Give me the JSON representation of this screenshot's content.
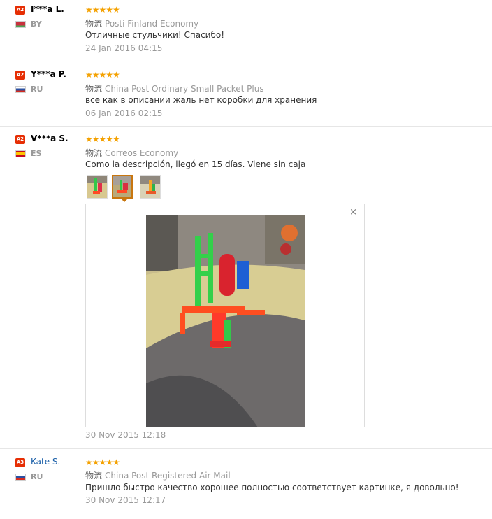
{
  "reviews": [
    {
      "level": "A2",
      "name": "I***a L.",
      "country": "BY",
      "stars": "★★★★★",
      "shipping_cn": "物流",
      "shipping": "Posti Finland Economy",
      "text": "Отличные стульчики! Спасибо!",
      "date": "24 Jan 2016 04:15"
    },
    {
      "level": "A2",
      "name": "Y***a P.",
      "country": "RU",
      "stars": "★★★★★",
      "shipping_cn": "物流",
      "shipping": "China Post Ordinary Small Packet Plus",
      "text": "все как в описании жаль нет коробки для хранения",
      "date": "06 Jan 2016 02:15"
    },
    {
      "level": "A2",
      "name": "V***a S.",
      "country": "ES",
      "stars": "★★★★★",
      "shipping_cn": "物流",
      "shipping": "Correos Economy",
      "text": "Como la descripción, llegó en 15 días. Viene sin caja",
      "date": "30 Nov 2015 12:18",
      "viewer_close": "×"
    },
    {
      "level": "A3",
      "name": "Kate S.",
      "country": "RU",
      "stars": "★★★★★",
      "shipping_cn": "物流",
      "shipping": "China Post Registered Air Mail",
      "text": "Пришло быстро качество хорошее полностью соответствует картинке, я довольно!",
      "date": "30 Nov 2015 12:17"
    }
  ],
  "colors": {
    "badge": "#e62e04",
    "star": "#f4a100",
    "link": "#1a5fa8",
    "selected_thumb": "#c8760f"
  }
}
